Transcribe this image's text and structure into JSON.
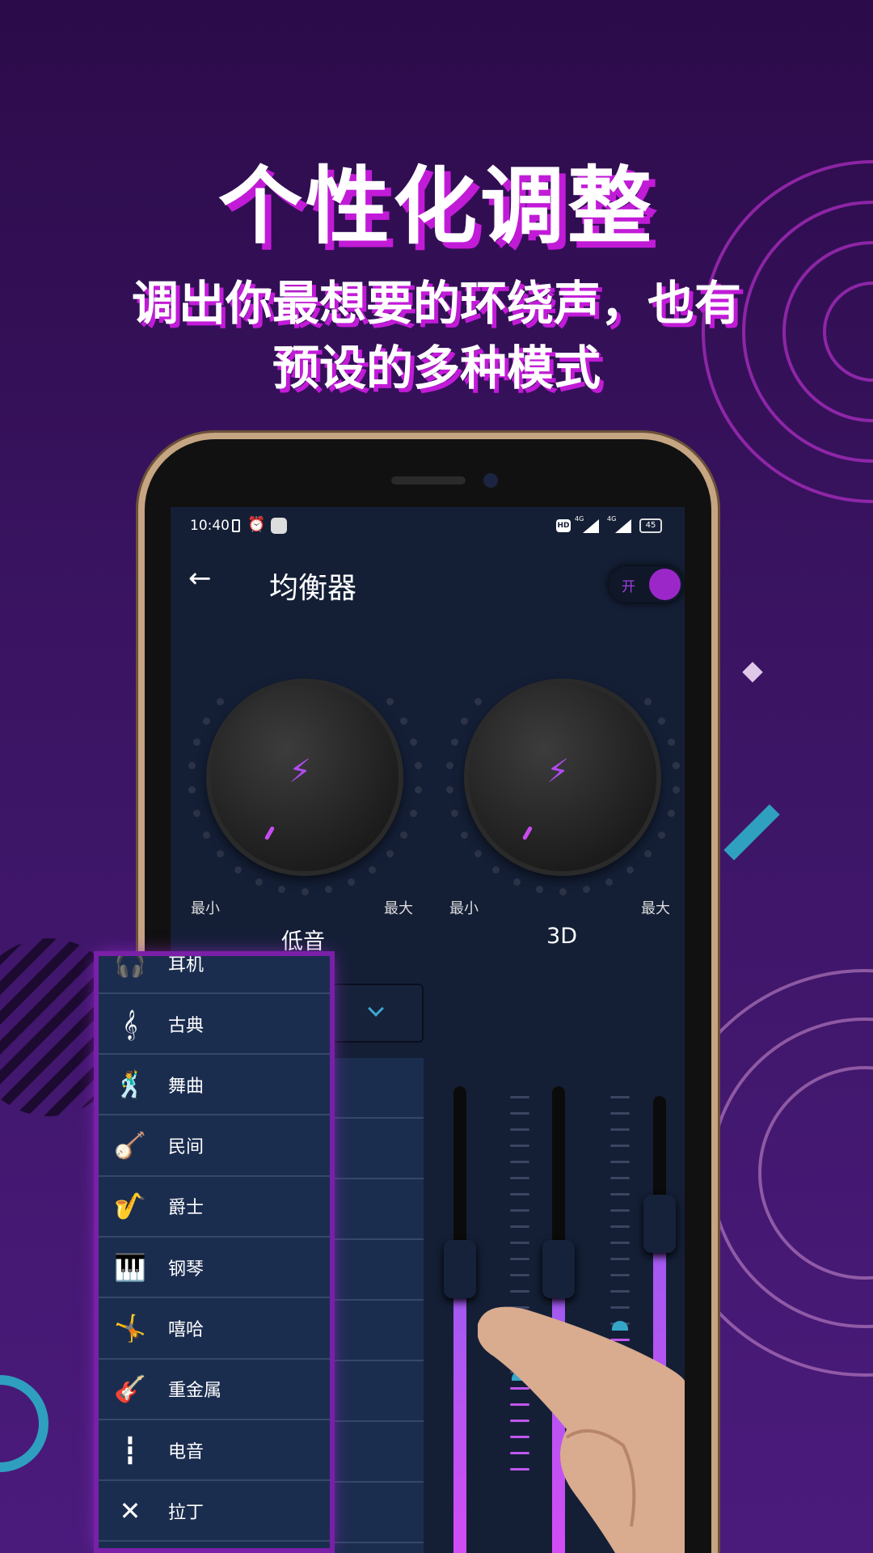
{
  "promo": {
    "title": "个性化调整",
    "subtitle_line1": "调出你最想要的环绕声，也有",
    "subtitle_line2": "预设的多种模式"
  },
  "status_bar": {
    "time": "10:40",
    "network1": "4G",
    "network2": "4G",
    "hd": "HD",
    "battery": "45"
  },
  "header": {
    "back_icon": "arrow-left-icon",
    "title": "均衡器",
    "toggle_label": "开",
    "toggle_on": true
  },
  "knobs": [
    {
      "label": "低音",
      "min_label": "最小",
      "max_label": "最大"
    },
    {
      "label": "3D",
      "min_label": "最小",
      "max_label": "最大"
    }
  ],
  "preset_dropdown": {
    "icon": "chevron-down-icon"
  },
  "preset_menu": [
    {
      "icon": "headphones-icon",
      "label": "耳机"
    },
    {
      "icon": "harp-icon",
      "label": "古典"
    },
    {
      "icon": "dancer-icon",
      "label": "舞曲"
    },
    {
      "icon": "banjo-icon",
      "label": "民间"
    },
    {
      "icon": "saxophone-icon",
      "label": "爵士"
    },
    {
      "icon": "piano-icon",
      "label": "钢琴"
    },
    {
      "icon": "breakdance-icon",
      "label": "嘻哈"
    },
    {
      "icon": "guitar-icon",
      "label": "重金属"
    },
    {
      "icon": "equalizer-icon",
      "label": "电音"
    },
    {
      "icon": "maracas-icon",
      "label": "拉丁"
    }
  ],
  "sliders": [
    {
      "level": 0.5
    },
    {
      "level": 0.5
    },
    {
      "level": 0.6
    }
  ],
  "colors": {
    "accent": "#a24cf2",
    "background": "#2c0b4a",
    "screen": "#141f36",
    "toggle": "#9c27c9",
    "tick_active": "#c156f0",
    "tick_idle": "#3a4560",
    "marker": "#35a6c8"
  }
}
